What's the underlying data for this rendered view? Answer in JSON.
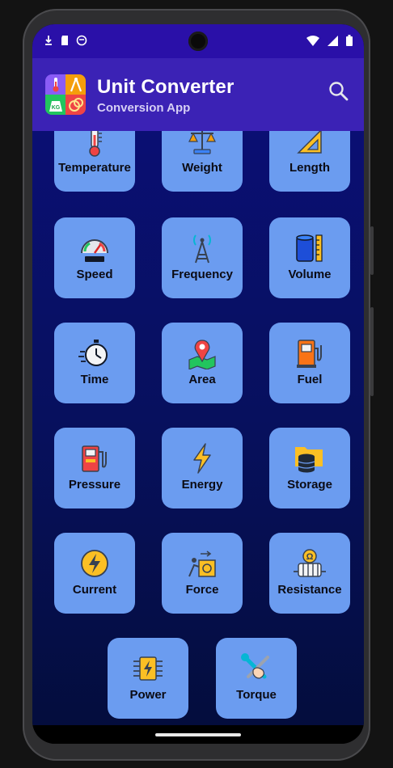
{
  "app": {
    "title": "Unit Converter",
    "subtitle": "Conversion App"
  },
  "colors": {
    "status_bar": "#2a10a8",
    "app_bar": "#3b22b5",
    "tile": "#6b9cf0",
    "background_top": "#0a0f73",
    "background_bottom": "#040d3d"
  },
  "categories": [
    {
      "label": "Temperature",
      "icon": "thermometer-icon"
    },
    {
      "label": "Weight",
      "icon": "scale-icon"
    },
    {
      "label": "Length",
      "icon": "ruler-triangle-icon"
    },
    {
      "label": "Speed",
      "icon": "speedometer-icon"
    },
    {
      "label": "Frequency",
      "icon": "antenna-tower-icon"
    },
    {
      "label": "Volume",
      "icon": "cylinder-icon"
    },
    {
      "label": "Time",
      "icon": "stopwatch-icon"
    },
    {
      "label": "Area",
      "icon": "map-pin-icon"
    },
    {
      "label": "Fuel",
      "icon": "fuel-pump-icon"
    },
    {
      "label": "Pressure",
      "icon": "gas-pump-icon"
    },
    {
      "label": "Energy",
      "icon": "lightning-bolt-icon"
    },
    {
      "label": "Storage",
      "icon": "database-folder-icon"
    },
    {
      "label": "Current",
      "icon": "electric-current-icon"
    },
    {
      "label": "Force",
      "icon": "push-force-icon"
    },
    {
      "label": "Resistance",
      "icon": "resistor-icon"
    },
    {
      "label": "Power",
      "icon": "power-chip-icon"
    },
    {
      "label": "Torque",
      "icon": "wrench-hand-icon"
    }
  ]
}
